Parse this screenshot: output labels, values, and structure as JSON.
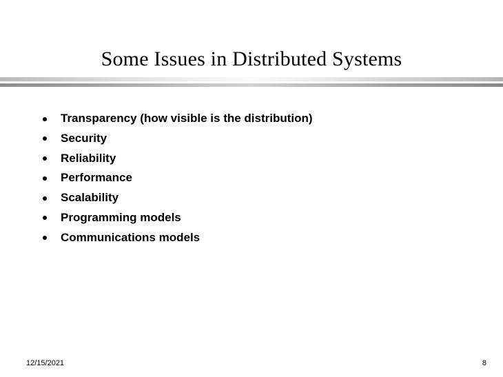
{
  "slide": {
    "title": "Some Issues in Distributed Systems",
    "background_color": "#ffffff",
    "text_color": "#000000",
    "bullets": [
      {
        "label": "Transparency (how visible is the distribution)"
      },
      {
        "label": "Security"
      },
      {
        "label": "Reliability"
      },
      {
        "label": "Performance"
      },
      {
        "label": "Scalability"
      },
      {
        "label": "Programming models"
      },
      {
        "label": "Communications models"
      }
    ],
    "divider": {
      "top_bar_color": "#c6c6c6",
      "bottom_bar_color": "#949494"
    },
    "footer": {
      "date": "12/15/2021",
      "page_number": "8"
    }
  }
}
